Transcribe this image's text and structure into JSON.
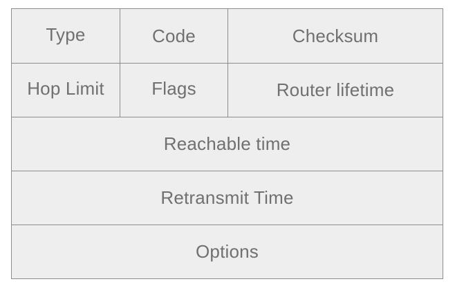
{
  "rows": [
    {
      "cells": [
        "Type",
        "Code",
        "Checksum"
      ]
    },
    {
      "cells": [
        "Hop Limit",
        "Flags",
        "Router lifetime"
      ]
    },
    {
      "cells": [
        "Reachable time"
      ]
    },
    {
      "cells": [
        "Retransmit Time"
      ]
    },
    {
      "cells": [
        "Options"
      ]
    }
  ]
}
